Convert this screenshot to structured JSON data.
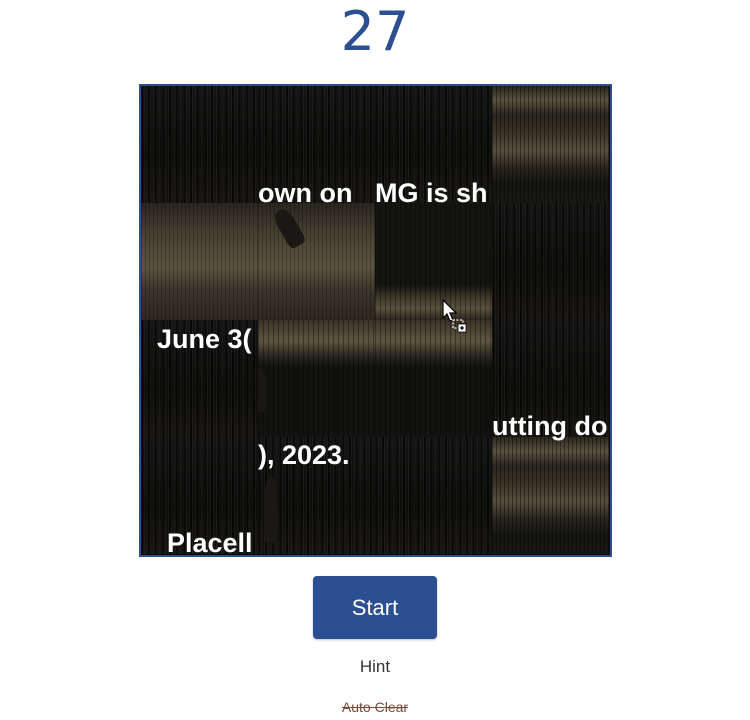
{
  "move_counter": "27",
  "board": {
    "tiles": {
      "r0c0": "",
      "r0c1": "own on",
      "r0c2": "MG is sh",
      "r0c3": "",
      "r1c0": "",
      "r1c1": "",
      "r1c2": "",
      "r1c3": "",
      "r2c0": "June 3(",
      "r2c1": "",
      "r2c2": "",
      "r2c3": "",
      "r3c0": "",
      "r3c1": "",
      "r3c2": "",
      "r3c3": "utting do",
      "r3c1_bottom": "), 2023.",
      "r4c0": "Placell"
    }
  },
  "controls": {
    "start_label": "Start",
    "hint_label": "Hint",
    "autoclear_label": "Auto Clear"
  },
  "colors": {
    "accent": "#2b4f91",
    "autoclear": "#7a4a3a"
  },
  "icons": {
    "cursor": "move-cursor-icon"
  }
}
